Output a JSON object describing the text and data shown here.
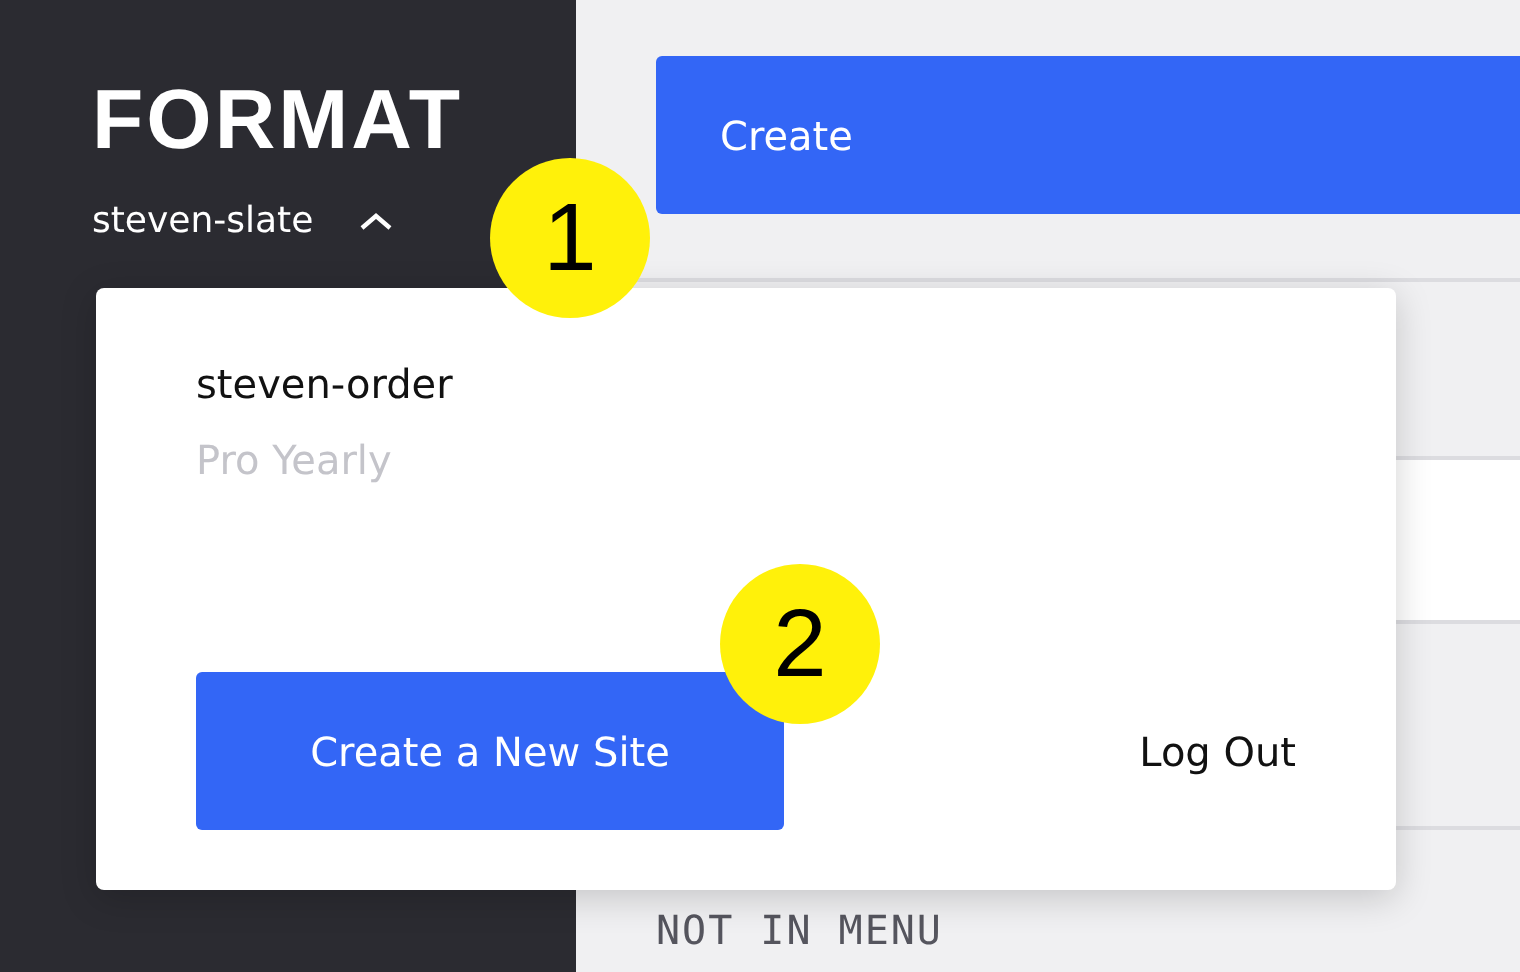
{
  "sidebar": {
    "logo": "FORMAT",
    "account_switch": {
      "label": "steven-slate",
      "expanded": true
    }
  },
  "main": {
    "create_button": "Create",
    "section_label": "NOT IN MENU"
  },
  "dropdown": {
    "site_name": "steven-order",
    "plan": "Pro Yearly",
    "primary_button": "Create a New Site",
    "secondary_link": "Log Out"
  },
  "annotations": [
    "1",
    "2"
  ]
}
